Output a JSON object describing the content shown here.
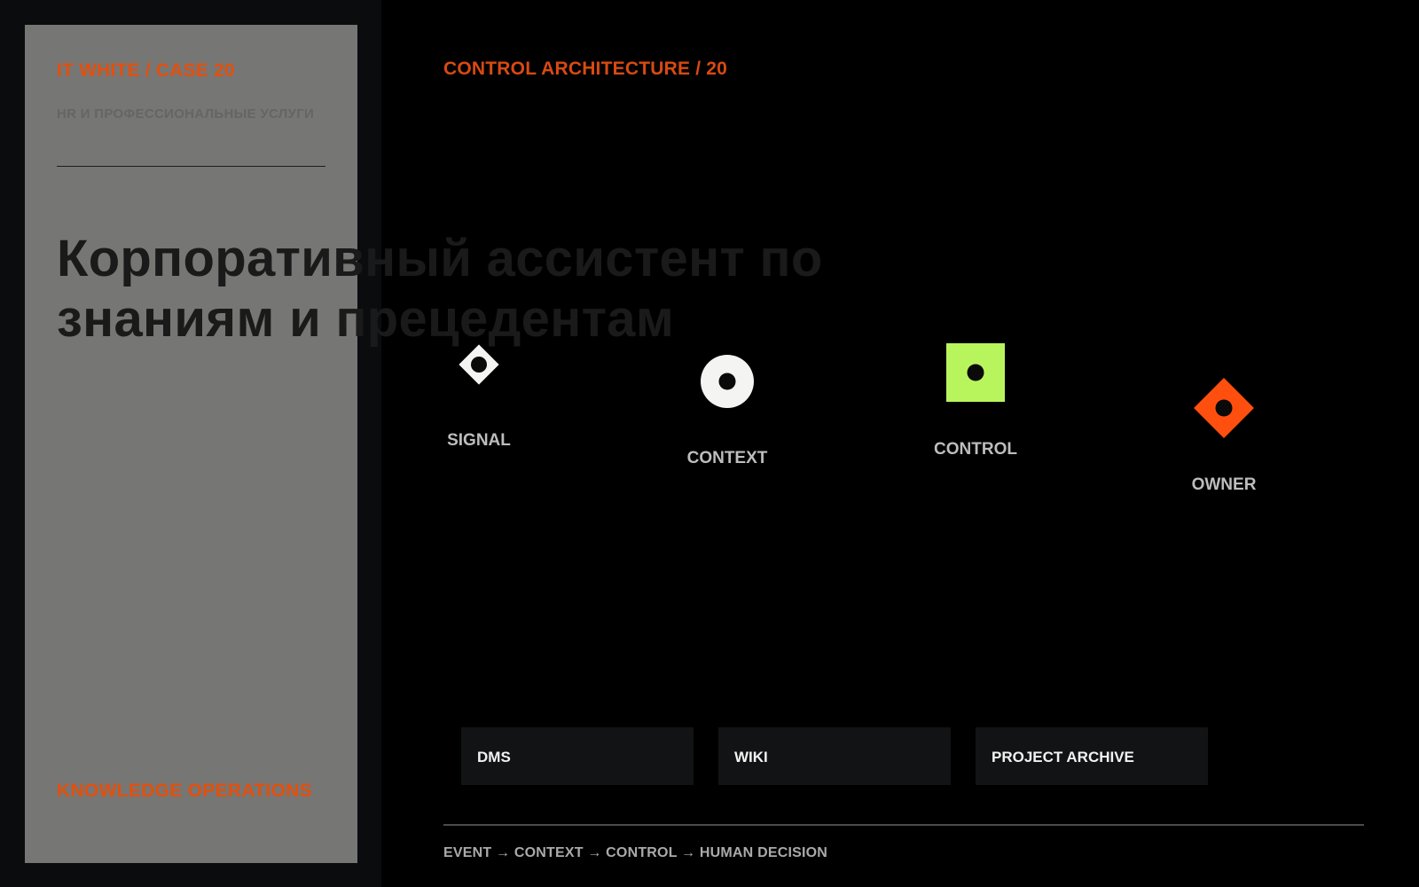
{
  "left_panel": {
    "case_label": "IT WHITE / CASE 20",
    "industry_label": "HR И ПРОФЕССИОНАЛЬНЫЕ УСЛУГИ",
    "title": "Корпоративный ассистент по знаниям и прецедентам",
    "footer_label": "KNOWLEDGE OPERATIONS"
  },
  "architecture": {
    "title": "CONTROL ARCHITECTURE / 20",
    "nodes": [
      {
        "label": "SIGNAL",
        "icon": "white-diamond-icon",
        "color": "#f4f4f2"
      },
      {
        "label": "CONTEXT",
        "icon": "white-circle-icon",
        "color": "#f4f4f2"
      },
      {
        "label": "CONTROL",
        "icon": "lime-square-icon",
        "color": "#b8f55c"
      },
      {
        "label": "OWNER",
        "icon": "orange-diamond-icon",
        "color": "#ff4f0f"
      }
    ],
    "sources": [
      {
        "label": "DMS"
      },
      {
        "label": "WIKI"
      },
      {
        "label": "PROJECT ARCHIVE"
      }
    ],
    "flow_text": "EVENT → CONTEXT → CONTROL → HUMAN DECISION"
  },
  "colors": {
    "accent": "#e2500e",
    "panel": "#767674",
    "background": "#000000"
  }
}
